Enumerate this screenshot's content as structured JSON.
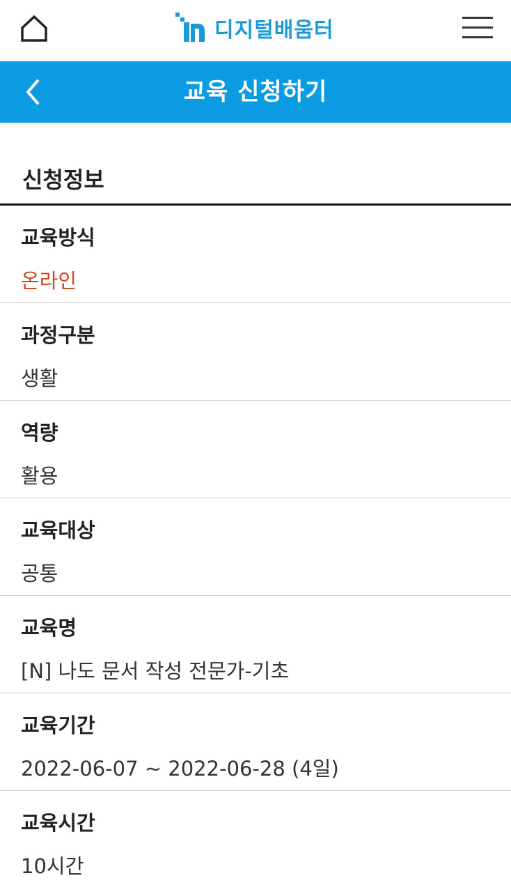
{
  "header": {
    "logo_text": "디지털배움터",
    "home_icon": "home-icon",
    "menu_icon": "hamburger-menu-icon",
    "brand_color": "#1a9ad6"
  },
  "title_bar": {
    "title": "교육 신청하기",
    "back_icon": "chevron-left-icon",
    "background_color": "#0b9be3"
  },
  "section": {
    "title": "신청정보"
  },
  "fields": [
    {
      "label": "교육방식",
      "value": "온라인",
      "value_color": "#d04a1f"
    },
    {
      "label": "과정구분",
      "value": "생활"
    },
    {
      "label": "역량",
      "value": "활용"
    },
    {
      "label": "교육대상",
      "value": "공통"
    },
    {
      "label": "교육명",
      "value": "[N] 나도 문서 작성 전문가-기초"
    },
    {
      "label": "교육기간",
      "value": "2022-06-07 ~ 2022-06-28 (4일)"
    },
    {
      "label": "교육시간",
      "value": "10시간"
    }
  ]
}
